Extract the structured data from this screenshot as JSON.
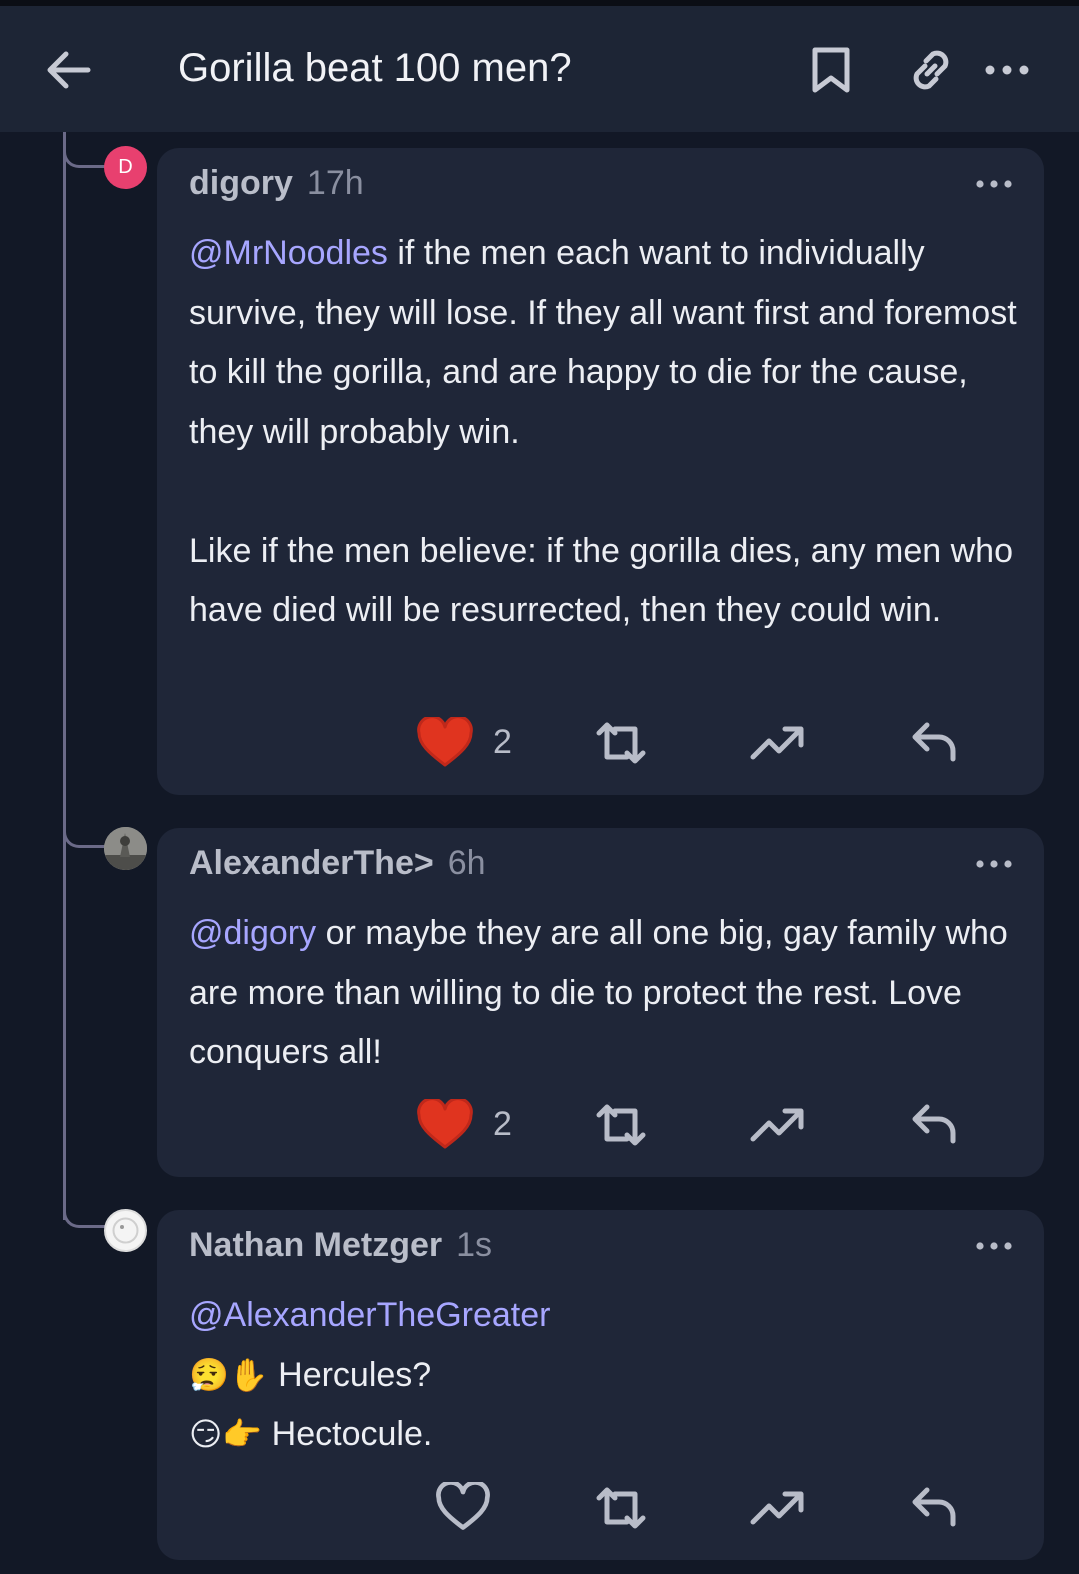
{
  "header": {
    "title": "Gorilla beat 100 men?"
  },
  "comments": [
    {
      "avatar_letter": "D",
      "author": "digory",
      "time": "17h",
      "mention": "@MrNoodles",
      "text_after_mention": " if the men each want to individually survive, they will lose. If they all want first and foremost to kill the gorilla, and are happy to die for the cause, they will probably win.",
      "paragraph2": "Like if the men believe: if the gorilla dies, any men who have died will be resurrected, then they could win.",
      "like_count": "2",
      "liked": true
    },
    {
      "author": "AlexanderThe>",
      "time": "6h",
      "mention": "@digory",
      "text_after_mention": " or maybe they are all one big, gay family who are more than willing to die to protect the rest. Love conquers all!",
      "like_count": "2",
      "liked": true
    },
    {
      "author": "Nathan Metzger",
      "time": "1s",
      "mention": "@AlexanderTheGreater",
      "line2_emoji": "😮‍💨✋",
      "line2_text": "Hercules?",
      "line3_emoji": "😏👉",
      "line3_text": "Hectocule.",
      "liked": false
    }
  ],
  "colors": {
    "background": "#121826",
    "header": "#1d2535",
    "card": "#1f2638",
    "mention": "#a7a6ff",
    "heart": "#e0341f",
    "thread_line": "#6b6a88"
  },
  "icons": [
    "back-arrow-icon",
    "bookmark-icon",
    "link-icon",
    "more-icon",
    "heart-icon",
    "repost-icon",
    "trending-icon",
    "reply-icon"
  ]
}
